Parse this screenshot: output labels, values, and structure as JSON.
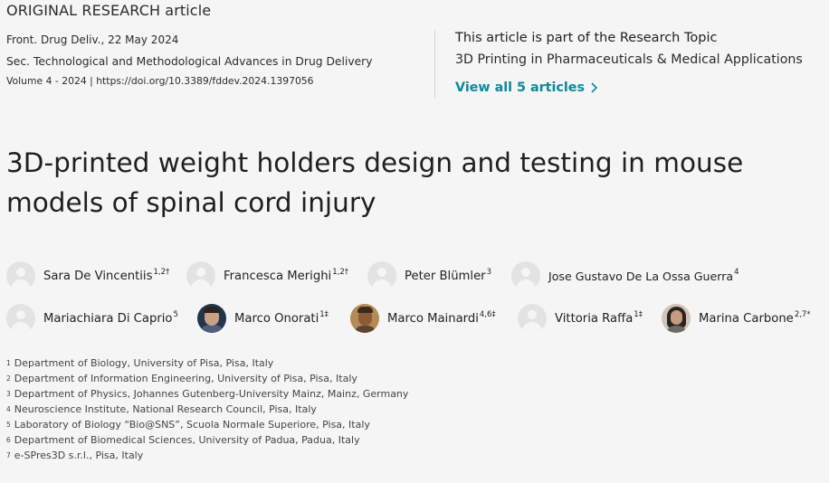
{
  "article_type": "ORIGINAL RESEARCH article",
  "journal_line": "Front. Drug Deliv., 22 May 2024",
  "section_line": "Sec. Technological and Methodological Advances in Drug Delivery",
  "volume_line": "Volume 4 - 2024 | https://doi.org/10.3389/fddev.2024.1397056",
  "research_topic": {
    "intro": "This article is part of the Research Topic",
    "name": "3D Printing in Pharmaceuticals & Medical Applications",
    "view_all": "View all 5 articles"
  },
  "title": "3D-printed weight holders design and testing in mouse models of spinal cord injury",
  "authors": [
    {
      "name": "Sara De Vincentiis",
      "sup": "1,2†"
    },
    {
      "name": "Francesca Merighi",
      "sup": "1,2†"
    },
    {
      "name": "Peter Blümler",
      "sup": "3"
    },
    {
      "name": "Jose Gustavo De La Ossa Guerra",
      "sup": "4"
    },
    {
      "name": "Mariachiara Di Caprio",
      "sup": "5"
    },
    {
      "name": "Marco Onorati",
      "sup": "1‡"
    },
    {
      "name": "Marco Mainardi",
      "sup": "4,6‡"
    },
    {
      "name": "Vittoria Raffa",
      "sup": "1‡"
    },
    {
      "name": "Marina Carbone",
      "sup": "2,7*"
    }
  ],
  "affiliations": [
    {
      "num": "1",
      "text": "Department of Biology, University of Pisa, Pisa, Italy"
    },
    {
      "num": "2",
      "text": "Department of Information Engineering, University of Pisa, Pisa, Italy"
    },
    {
      "num": "3",
      "text": "Department of Physics, Johannes Gutenberg-University Mainz, Mainz, Germany"
    },
    {
      "num": "4",
      "text": "Neuroscience Institute, National Research Council, Pisa, Italy"
    },
    {
      "num": "5",
      "text": "Laboratory of Biology “Bio@SNS”, Scuola Normale Superiore, Pisa, Italy"
    },
    {
      "num": "6",
      "text": "Department of Biomedical Sciences, University of Padua, Padua, Italy"
    },
    {
      "num": "7",
      "text": "e-SPres3D s.r.l., Pisa, Italy"
    }
  ],
  "colors": {
    "accent": "#0a8a9a",
    "background": "#f5f5f5"
  }
}
